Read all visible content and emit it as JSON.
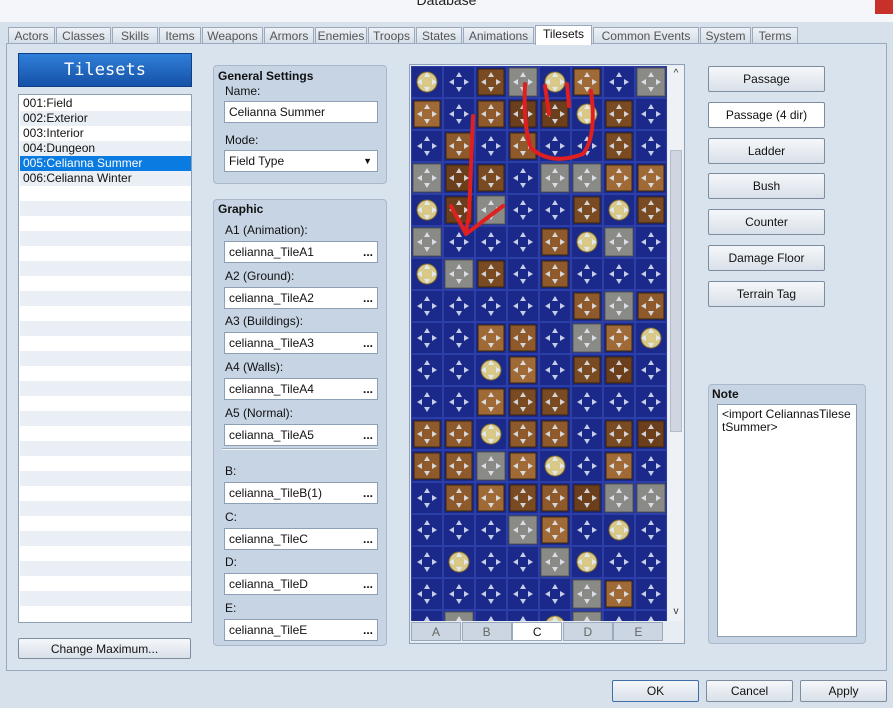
{
  "window": {
    "title": "Database"
  },
  "tabs": [
    "Actors",
    "Classes",
    "Skills",
    "Items",
    "Weapons",
    "Armors",
    "Enemies",
    "Troops",
    "States",
    "Animations",
    "Tilesets",
    "Common Events",
    "System",
    "Terms"
  ],
  "active_tab": "Tilesets",
  "tileset_list": {
    "header": "Tilesets",
    "items": [
      "001:Field",
      "002:Exterior",
      "003:Interior",
      "004:Dungeon",
      "005:Celianna Summer",
      "006:Celianna Winter"
    ],
    "selected_index": 4,
    "change_max_label": "Change Maximum..."
  },
  "general": {
    "title": "General Settings",
    "name_label": "Name:",
    "name_value": "Celianna Summer",
    "mode_label": "Mode:",
    "mode_value": "Field Type"
  },
  "graphic": {
    "title": "Graphic",
    "fields": [
      {
        "label": "A1 (Animation):",
        "value": "celianna_TileA1"
      },
      {
        "label": "A2 (Ground):",
        "value": "celianna_TileA2"
      },
      {
        "label": "A3 (Buildings):",
        "value": "celianna_TileA3"
      },
      {
        "label": "A4 (Walls):",
        "value": "celianna_TileA4"
      },
      {
        "label": "A5 (Normal):",
        "value": "celianna_TileA5"
      },
      {
        "label": "B:",
        "value": "celianna_TileB(1)"
      },
      {
        "label": "C:",
        "value": "celianna_TileC"
      },
      {
        "label": "D:",
        "value": "celianna_TileD"
      },
      {
        "label": "E:",
        "value": "celianna_TileE"
      }
    ],
    "browse_glyph": "..."
  },
  "palette": {
    "tabs": [
      "A",
      "B",
      "C",
      "D",
      "E"
    ],
    "active_tab": "C",
    "scroll_up": "^",
    "scroll_down": "v"
  },
  "modes": {
    "buttons": [
      "Passage",
      "Passage (4 dir)",
      "Ladder",
      "Bush",
      "Counter",
      "Damage Floor",
      "Terrain Tag"
    ],
    "active": "Passage (4 dir)"
  },
  "note": {
    "title": "Note",
    "text": "<import CeliannasTilesetSummer>"
  },
  "dialog": {
    "ok": "OK",
    "cancel": "Cancel",
    "apply": "Apply"
  },
  "colors": {
    "selection": "#0a7be0",
    "tile_bg": "#1b2a8a",
    "header_bg": "#1e66c4",
    "annotation": "#e02020"
  }
}
